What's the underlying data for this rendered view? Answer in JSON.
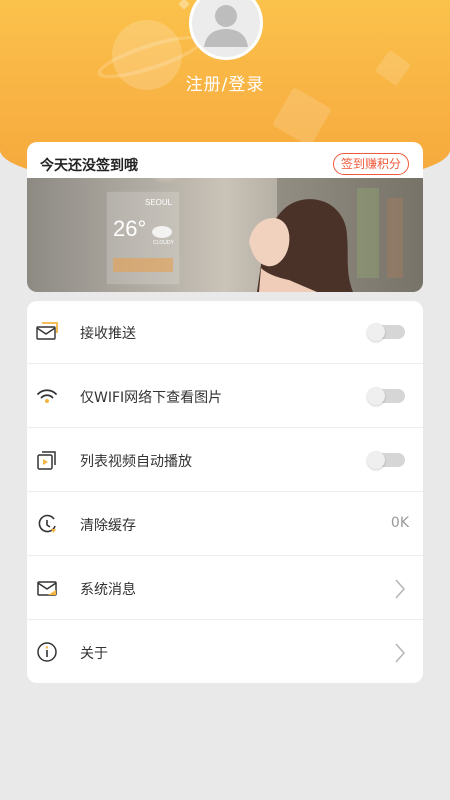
{
  "header": {
    "login_label": "注册/登录",
    "gradient_top": "#fbc24b",
    "gradient_bottom": "#f5a83a"
  },
  "checkin": {
    "title": "今天还没签到哦",
    "button_label": "签到赚积分",
    "accent": "#f05a3a",
    "banner": {
      "city": "SEOUL",
      "temperature": "26°",
      "condition": "CLOUDY"
    }
  },
  "settings": {
    "items": [
      {
        "icon": "push-mail-icon",
        "label": "接收推送",
        "control": "toggle",
        "on": false
      },
      {
        "icon": "wifi-icon",
        "label": "仅WIFI网络下查看图片",
        "control": "toggle",
        "on": false
      },
      {
        "icon": "video-list-icon",
        "label": "列表视频自动播放",
        "control": "toggle",
        "on": false
      },
      {
        "icon": "clock-clear-icon",
        "label": "清除缓存",
        "control": "value",
        "value": "0K"
      },
      {
        "icon": "envelope-icon",
        "label": "系统消息",
        "control": "chevron"
      },
      {
        "icon": "info-icon",
        "label": "关于",
        "control": "chevron"
      }
    ]
  },
  "colors": {
    "icon_accent": "#f5b53f",
    "page_bg": "#e9e9e9"
  }
}
